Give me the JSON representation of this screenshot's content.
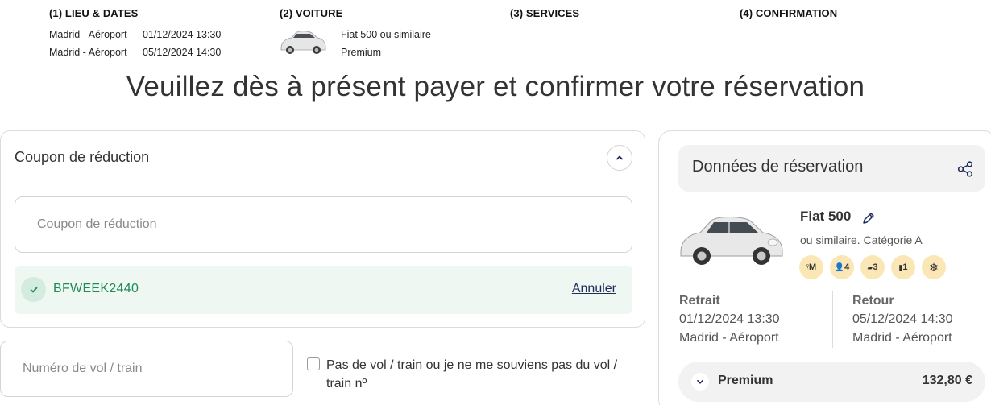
{
  "steps": [
    {
      "label": "(1) LIEU & DATES"
    },
    {
      "label": "(2) VOITURE"
    },
    {
      "label": "(3) SERVICES"
    },
    {
      "label": "(4) CONFIRMATION"
    }
  ],
  "summary": {
    "pickup_place": "Madrid - Aéroport",
    "pickup_datetime": "01/12/2024 13:30",
    "return_place": "Madrid - Aéroport",
    "return_datetime": "05/12/2024 14:30",
    "car_model": "Fiat 500 ou similaire",
    "car_class": "Premium"
  },
  "headline": "Veuillez dès à présent payer et confirmer votre réservation",
  "coupon": {
    "title": "Coupon de réduction",
    "input_placeholder": "Coupon de réduction",
    "input_value": "",
    "applied_code": "BFWEEK2440",
    "cancel_label": "Annuler"
  },
  "flight": {
    "input_placeholder": "Numéro de vol / train",
    "input_value": "",
    "no_flight_label": "Pas de vol / train ou je ne me souviens pas du vol / train nº",
    "no_flight_checked": false
  },
  "reservation": {
    "title": "Données de réservation",
    "car_name": "Fiat 500",
    "car_sub": "ou similaire. Catégorie A",
    "features": [
      {
        "icon": "transmission-manual-icon",
        "text": "M"
      },
      {
        "icon": "passenger-icon",
        "text": "4"
      },
      {
        "icon": "door-icon",
        "text": "3"
      },
      {
        "icon": "luggage-icon",
        "text": "1"
      },
      {
        "icon": "air-conditioning-icon",
        "text": "❄"
      }
    ],
    "pickup_label": "Retrait",
    "pickup_datetime": "01/12/2024 13:30",
    "pickup_place": "Madrid - Aéroport",
    "return_label": "Retour",
    "return_datetime": "05/12/2024 14:30",
    "return_place": "Madrid - Aéroport",
    "package_name": "Premium",
    "package_price": "132,80 €"
  },
  "colors": {
    "accent_green": "#1e8a55",
    "applied_bg": "#eef7f2",
    "feature_badge": "#fbe7b6",
    "link_navy": "#1f2b5c"
  }
}
